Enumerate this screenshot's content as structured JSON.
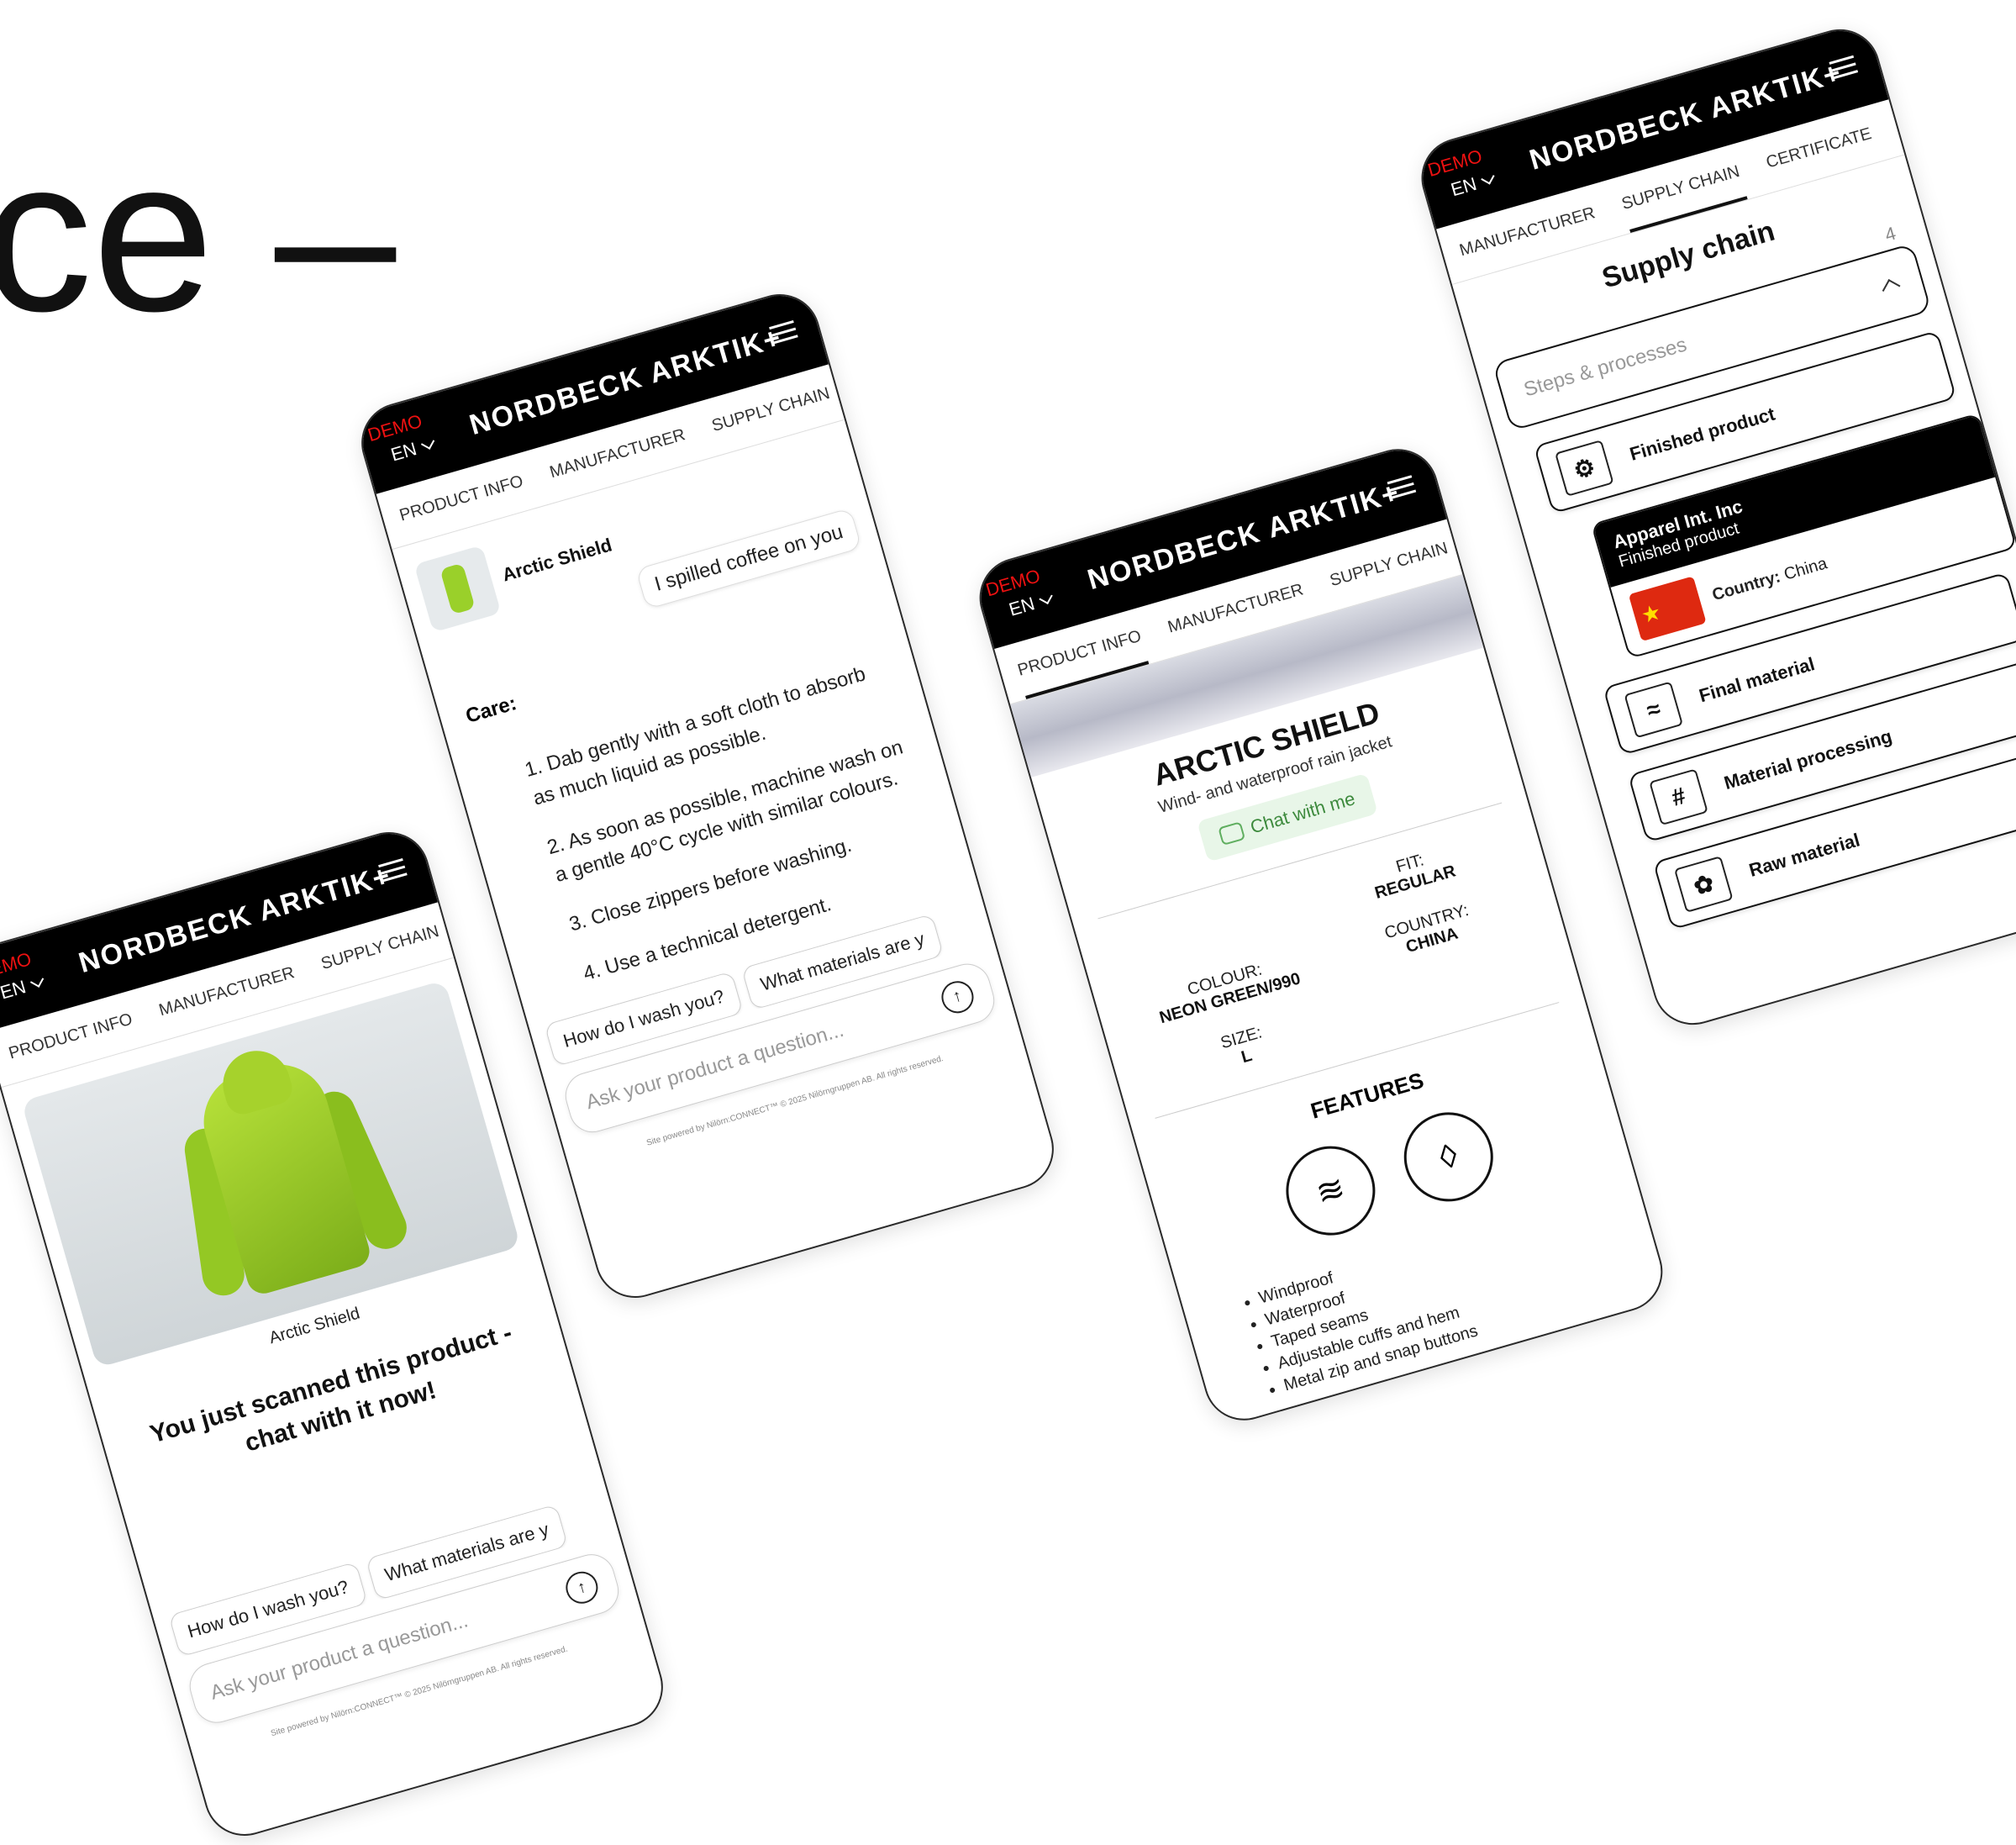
{
  "headline": "ce –",
  "common": {
    "demo": "DEMO",
    "lang": "EN",
    "brand": "NORDBECK ARKTIK+",
    "footer": "Site powered by Nilörn:CONNECT™ © 2025 Nilörngruppen AB. All rights reserved."
  },
  "phone1": {
    "tabs": [
      "PRODUCT INFO",
      "MANUFACTURER",
      "SUPPLY CHAIN"
    ],
    "image_caption": "Arctic Shield",
    "scan_message": "You just scanned this product - chat with it now!",
    "chips": [
      "How do I wash you?",
      "What materials are y"
    ],
    "ask_placeholder": "Ask your product a question..."
  },
  "phone2": {
    "tabs": [
      "PRODUCT INFO",
      "MANUFACTURER",
      "SUPPLY CHAIN"
    ],
    "product_name": "Arctic Shield",
    "user_message": "I spilled coffee on you",
    "care_heading": "Care:",
    "care_steps": [
      "1. Dab gently with a soft cloth to absorb as much liquid as possible.",
      "2. As soon as possible, machine wash on a gentle 40°C cycle with similar colours.",
      "3. Close zippers before washing.",
      "4. Use a technical detergent."
    ],
    "chips": [
      "How do I wash you?",
      "What materials are y"
    ],
    "ask_placeholder": "Ask your product a question..."
  },
  "phone3": {
    "tabs": [
      "PRODUCT INFO",
      "MANUFACTURER",
      "SUPPLY CHAIN"
    ],
    "title": "ARCTIC SHIELD",
    "subtitle": "Wind- and waterproof rain jacket",
    "chat_button": "Chat with me",
    "specs": {
      "fit_label": "FIT:",
      "fit_value": "REGULAR",
      "colour_label": "COLOUR:",
      "colour_value": "NEON GREEN/990",
      "country_label": "COUNTRY:",
      "country_value": "CHINA",
      "size_label": "SIZE:",
      "size_value": "L"
    },
    "features_heading": "FEATURES",
    "features": [
      "Windproof",
      "Waterproof",
      "Taped seams",
      "Adjustable cuffs and hem",
      "Metal zip and snap buttons"
    ]
  },
  "phone4": {
    "tabs": [
      "MANUFACTURER",
      "SUPPLY CHAIN",
      "CERTIFICATE"
    ],
    "title": "Supply chain",
    "count": "4",
    "steps_label": "Steps & processes",
    "steps": [
      "Finished product",
      "Final material",
      "Material processing",
      "Raw material"
    ],
    "actor": {
      "name": "Apparel Int. Inc",
      "role": "Finished product",
      "country_label": "Country:",
      "country_value": "China"
    }
  }
}
